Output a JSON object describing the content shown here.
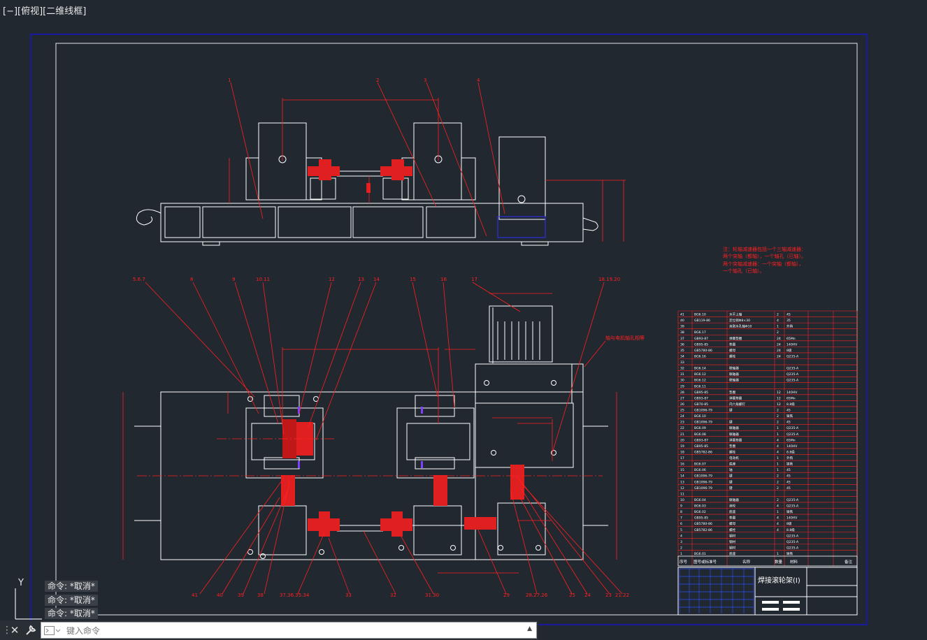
{
  "viewport_label": "[−][俯视][二维线框]",
  "ucs": {
    "y_label": "Y"
  },
  "colors": {
    "background": "#212830",
    "red": "#ff2020",
    "white": "#ffffff",
    "blue": "#1a1aa0"
  },
  "drawing": {
    "title": "焊接滚轮架(Ⅰ)",
    "note_lines": [
      "注：轮轴减速器包括一个三轴减速器：",
      "两个突轴（都轴），一个轴孔（已轴）。",
      "两个突轴减速器：一个突轴（都轴），",
      "一个轴孔（已轴）。"
    ],
    "callout": "轴与电机轴孔相等",
    "top_labels": [
      "5.6.7",
      "8",
      "9",
      "10.11",
      "12",
      "13",
      "14",
      "15",
      "16",
      "17",
      "18.19.20"
    ],
    "top_view_labels": [
      "1",
      "2",
      "3",
      "4"
    ],
    "bottom_labels": [
      "41",
      "40",
      "39",
      "38",
      "37.36.35.34",
      "33",
      "32",
      "31.30",
      "29",
      "28.27.26",
      "25",
      "24",
      "23",
      "21.22"
    ],
    "bom_rows": [
      [
        "41",
        "BG6.10",
        "水平上轴",
        "2",
        "45"
      ],
      [
        "40",
        "GB119-86",
        "定位销Φ8×30",
        "4",
        "35"
      ],
      [
        "39",
        "",
        "滚割水孔轴Φ10",
        "1",
        "外购"
      ],
      [
        "38",
        "BG6.17",
        "",
        "2",
        ""
      ],
      [
        "37",
        "GB93-87",
        "弹簧垫圈",
        "24",
        "65Mn"
      ],
      [
        "36",
        "GB95-85",
        "垫圈",
        "24",
        "140HV"
      ],
      [
        "35",
        "GB5780-86",
        "螺母",
        "24",
        "8级"
      ],
      [
        "34",
        "BG6.16",
        "螺栓",
        "24",
        "Q235-A"
      ],
      [
        "33",
        "",
        "",
        "",
        ""
      ],
      [
        "32",
        "BG6.14",
        "联轴器",
        "",
        "Q235-A"
      ],
      [
        "31",
        "BG6.12",
        "联轴器",
        "",
        "Q235-A"
      ],
      [
        "30",
        "BG6.12",
        "联轴器",
        "",
        "Q235-A"
      ],
      [
        "29",
        "BG6.11",
        "",
        "",
        ""
      ],
      [
        "28",
        "GB95-85",
        "垫圈",
        "12",
        "140HV"
      ],
      [
        "27",
        "GB93-87",
        "弹簧垫圈",
        "12",
        "65Mn"
      ],
      [
        "26",
        "GB70-85",
        "内六角螺钉",
        "12",
        "8.8级"
      ],
      [
        "25",
        "GB1096-79",
        "键",
        "2",
        "45"
      ],
      [
        "24",
        "BG6.10",
        "",
        "2",
        "铸铁"
      ],
      [
        "23",
        "GB1096-79",
        "键",
        "2",
        "45"
      ],
      [
        "22",
        "BG6.09",
        "联轴器",
        "1",
        "Q235-A"
      ],
      [
        "21",
        "BG6.08",
        "联轴器",
        "1",
        "Q235-A"
      ],
      [
        "20",
        "GB93-87",
        "弹簧垫圈",
        "4",
        "65Mn"
      ],
      [
        "19",
        "GB95-85",
        "垫圈",
        "4",
        "140HV"
      ],
      [
        "18",
        "GB5782-86",
        "螺栓",
        "4",
        "8.8级"
      ],
      [
        "17",
        "",
        "电动机",
        "1",
        "外购"
      ],
      [
        "16",
        "BG6.07",
        "底座",
        "1",
        "铸铁"
      ],
      [
        "15",
        "BG6.06",
        "轴",
        "1",
        "45"
      ],
      [
        "14",
        "GB1096-79",
        "键",
        "2",
        "45"
      ],
      [
        "13",
        "GB1096-79",
        "键",
        "2",
        "45"
      ],
      [
        "12",
        "GB1096-79",
        "键",
        "2",
        "45"
      ],
      [
        "11",
        "",
        "",
        "",
        ""
      ],
      [
        "10",
        "BG6.04",
        "联轴器",
        "2",
        "Q235-A"
      ],
      [
        "9",
        "BG6.03",
        "滚轮",
        "4",
        "Q235-A"
      ],
      [
        "8",
        "BG6.02",
        "底座",
        "1",
        "铸铁"
      ],
      [
        "7",
        "GB95-85",
        "垫圈",
        "4",
        "140HV"
      ],
      [
        "6",
        "GB5780-86",
        "螺母",
        "4",
        "8级"
      ],
      [
        "5",
        "GB5782-86",
        "螺栓",
        "4",
        "8.8级"
      ],
      [
        "4",
        "",
        "钢材",
        "",
        "Q235-A"
      ],
      [
        "3",
        "",
        "钢材",
        "",
        "Q235-A"
      ],
      [
        "2",
        "",
        "钢材",
        "",
        "Q235-A"
      ],
      [
        "1",
        "BG6.01",
        "底座",
        "1",
        "铸铁"
      ]
    ],
    "bom_header": [
      "序号",
      "图号或标准号",
      "名称",
      "数量",
      "材料",
      "备注"
    ]
  },
  "command_history": [
    "命令: *取消*",
    "命令: *取消*",
    "命令: *取消*"
  ],
  "command_input": {
    "placeholder": "键入命令"
  }
}
